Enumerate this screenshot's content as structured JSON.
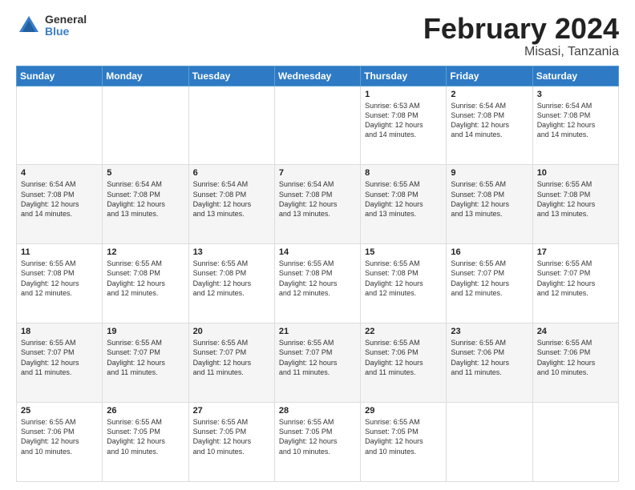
{
  "logo": {
    "general": "General",
    "blue": "Blue"
  },
  "title": "February 2024",
  "location": "Misasi, Tanzania",
  "days_of_week": [
    "Sunday",
    "Monday",
    "Tuesday",
    "Wednesday",
    "Thursday",
    "Friday",
    "Saturday"
  ],
  "weeks": [
    {
      "days": [
        {
          "number": "",
          "info": ""
        },
        {
          "number": "",
          "info": ""
        },
        {
          "number": "",
          "info": ""
        },
        {
          "number": "",
          "info": ""
        },
        {
          "number": "1",
          "info": "Sunrise: 6:53 AM\nSunset: 7:08 PM\nDaylight: 12 hours\nand 14 minutes."
        },
        {
          "number": "2",
          "info": "Sunrise: 6:54 AM\nSunset: 7:08 PM\nDaylight: 12 hours\nand 14 minutes."
        },
        {
          "number": "3",
          "info": "Sunrise: 6:54 AM\nSunset: 7:08 PM\nDaylight: 12 hours\nand 14 minutes."
        }
      ]
    },
    {
      "days": [
        {
          "number": "4",
          "info": "Sunrise: 6:54 AM\nSunset: 7:08 PM\nDaylight: 12 hours\nand 14 minutes."
        },
        {
          "number": "5",
          "info": "Sunrise: 6:54 AM\nSunset: 7:08 PM\nDaylight: 12 hours\nand 13 minutes."
        },
        {
          "number": "6",
          "info": "Sunrise: 6:54 AM\nSunset: 7:08 PM\nDaylight: 12 hours\nand 13 minutes."
        },
        {
          "number": "7",
          "info": "Sunrise: 6:54 AM\nSunset: 7:08 PM\nDaylight: 12 hours\nand 13 minutes."
        },
        {
          "number": "8",
          "info": "Sunrise: 6:55 AM\nSunset: 7:08 PM\nDaylight: 12 hours\nand 13 minutes."
        },
        {
          "number": "9",
          "info": "Sunrise: 6:55 AM\nSunset: 7:08 PM\nDaylight: 12 hours\nand 13 minutes."
        },
        {
          "number": "10",
          "info": "Sunrise: 6:55 AM\nSunset: 7:08 PM\nDaylight: 12 hours\nand 13 minutes."
        }
      ]
    },
    {
      "days": [
        {
          "number": "11",
          "info": "Sunrise: 6:55 AM\nSunset: 7:08 PM\nDaylight: 12 hours\nand 12 minutes."
        },
        {
          "number": "12",
          "info": "Sunrise: 6:55 AM\nSunset: 7:08 PM\nDaylight: 12 hours\nand 12 minutes."
        },
        {
          "number": "13",
          "info": "Sunrise: 6:55 AM\nSunset: 7:08 PM\nDaylight: 12 hours\nand 12 minutes."
        },
        {
          "number": "14",
          "info": "Sunrise: 6:55 AM\nSunset: 7:08 PM\nDaylight: 12 hours\nand 12 minutes."
        },
        {
          "number": "15",
          "info": "Sunrise: 6:55 AM\nSunset: 7:08 PM\nDaylight: 12 hours\nand 12 minutes."
        },
        {
          "number": "16",
          "info": "Sunrise: 6:55 AM\nSunset: 7:07 PM\nDaylight: 12 hours\nand 12 minutes."
        },
        {
          "number": "17",
          "info": "Sunrise: 6:55 AM\nSunset: 7:07 PM\nDaylight: 12 hours\nand 12 minutes."
        }
      ]
    },
    {
      "days": [
        {
          "number": "18",
          "info": "Sunrise: 6:55 AM\nSunset: 7:07 PM\nDaylight: 12 hours\nand 11 minutes."
        },
        {
          "number": "19",
          "info": "Sunrise: 6:55 AM\nSunset: 7:07 PM\nDaylight: 12 hours\nand 11 minutes."
        },
        {
          "number": "20",
          "info": "Sunrise: 6:55 AM\nSunset: 7:07 PM\nDaylight: 12 hours\nand 11 minutes."
        },
        {
          "number": "21",
          "info": "Sunrise: 6:55 AM\nSunset: 7:07 PM\nDaylight: 12 hours\nand 11 minutes."
        },
        {
          "number": "22",
          "info": "Sunrise: 6:55 AM\nSunset: 7:06 PM\nDaylight: 12 hours\nand 11 minutes."
        },
        {
          "number": "23",
          "info": "Sunrise: 6:55 AM\nSunset: 7:06 PM\nDaylight: 12 hours\nand 11 minutes."
        },
        {
          "number": "24",
          "info": "Sunrise: 6:55 AM\nSunset: 7:06 PM\nDaylight: 12 hours\nand 10 minutes."
        }
      ]
    },
    {
      "days": [
        {
          "number": "25",
          "info": "Sunrise: 6:55 AM\nSunset: 7:06 PM\nDaylight: 12 hours\nand 10 minutes."
        },
        {
          "number": "26",
          "info": "Sunrise: 6:55 AM\nSunset: 7:05 PM\nDaylight: 12 hours\nand 10 minutes."
        },
        {
          "number": "27",
          "info": "Sunrise: 6:55 AM\nSunset: 7:05 PM\nDaylight: 12 hours\nand 10 minutes."
        },
        {
          "number": "28",
          "info": "Sunrise: 6:55 AM\nSunset: 7:05 PM\nDaylight: 12 hours\nand 10 minutes."
        },
        {
          "number": "29",
          "info": "Sunrise: 6:55 AM\nSunset: 7:05 PM\nDaylight: 12 hours\nand 10 minutes."
        },
        {
          "number": "",
          "info": ""
        },
        {
          "number": "",
          "info": ""
        }
      ]
    }
  ]
}
